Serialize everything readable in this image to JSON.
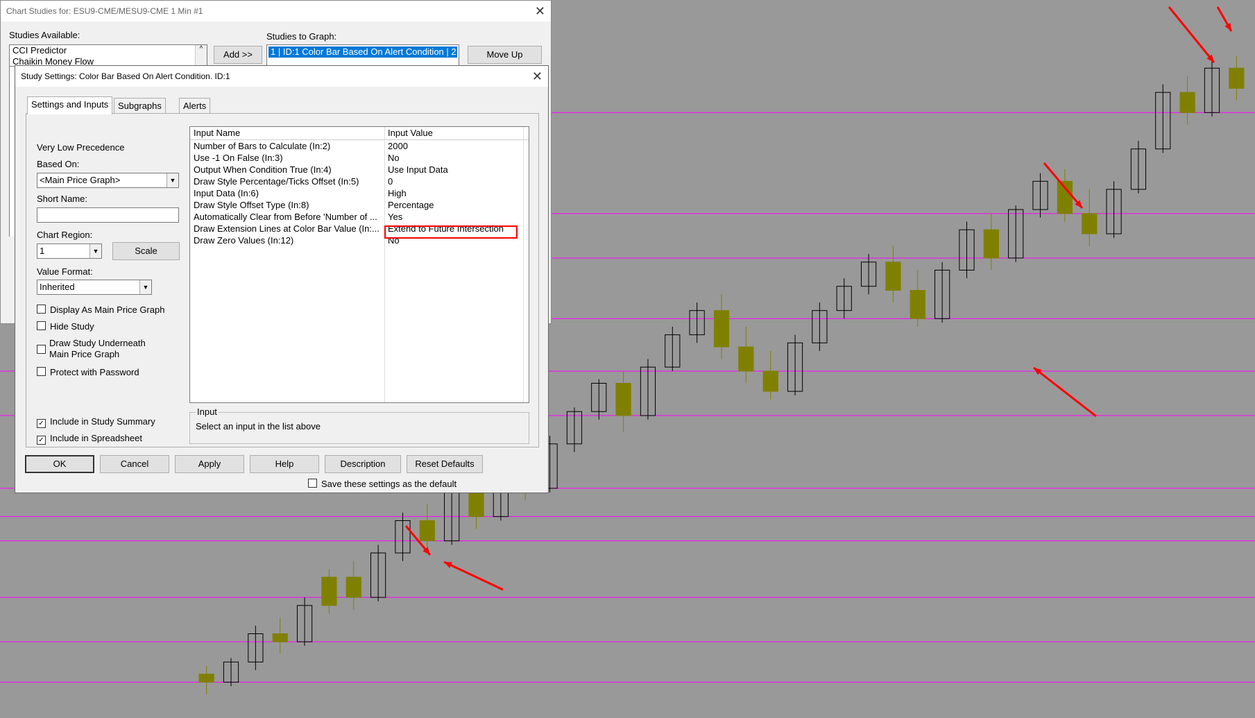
{
  "outer_window": {
    "title": "Chart Studies for: ESU9-CME/MESU9-CME  1 Min  #1",
    "studies_available_label": "Studies Available:",
    "studies_available": [
      "CCI Predictor",
      "Chaikin Money Flow"
    ],
    "add_button": "Add >>",
    "studies_to_graph_label": "Studies to Graph:",
    "studies_to_graph": [
      "1 | ID:1  Color Bar Based On Alert Condition | 2"
    ],
    "move_up_button": "Move Up"
  },
  "dialog": {
    "title": "Study Settings: Color Bar Based On Alert Condition. ID:1",
    "tabs": [
      {
        "label": "Settings and Inputs",
        "active": true
      },
      {
        "label": "Subgraphs",
        "active": false
      },
      {
        "label": "Alerts",
        "active": false
      }
    ],
    "precedence": "Very Low Precedence",
    "based_on_label": "Based On:",
    "based_on_value": "<Main Price Graph>",
    "short_name_label": "Short Name:",
    "short_name_value": "",
    "chart_region_label": "Chart Region:",
    "chart_region_value": "1",
    "scale_button": "Scale",
    "value_format_label": "Value Format:",
    "value_format_value": "Inherited",
    "checkboxes_top": [
      {
        "label": "Display As Main Price Graph",
        "checked": false
      },
      {
        "label": "Hide Study",
        "checked": false
      },
      {
        "label": "Draw Study Underneath Main Price Graph",
        "checked": false
      },
      {
        "label": "Protect with Password",
        "checked": false
      }
    ],
    "draw_underneath_line1": "Draw Study Underneath",
    "draw_underneath_line2": "Main Price Graph",
    "checkboxes_bottom": [
      {
        "label": "Include in Study Summary",
        "checked": true
      },
      {
        "label": "Include in Spreadsheet",
        "checked": true
      }
    ],
    "grid": {
      "col_name": "Input Name",
      "col_value": "Input Value",
      "rows": [
        {
          "name": "Number of Bars to Calculate  (In:2)",
          "value": "2000"
        },
        {
          "name": "Use -1 On False  (In:3)",
          "value": "No"
        },
        {
          "name": "Output When Condition True  (In:4)",
          "value": "Use Input Data"
        },
        {
          "name": "Draw Style Percentage/Ticks Offset  (In:5)",
          "value": "0"
        },
        {
          "name": "Input Data  (In:6)",
          "value": "High"
        },
        {
          "name": "Draw Style Offset Type  (In:8)",
          "value": "Percentage"
        },
        {
          "name": "Automatically Clear from Before 'Number of ...",
          "value": "Yes"
        },
        {
          "name": "Draw Extension Lines at Color Bar Value  (In:...",
          "value": "Extend to Future Intersection"
        },
        {
          "name": "Draw Zero Values  (In:12)",
          "value": "No"
        }
      ]
    },
    "input_group_label": "Input",
    "input_help": "Select an input in the list above",
    "buttons": {
      "ok": "OK",
      "cancel": "Cancel",
      "apply": "Apply",
      "help": "Help",
      "description": "Description",
      "reset": "Reset Defaults"
    },
    "save_default_label": "Save these settings as the default",
    "save_default_checked": false
  },
  "colors": {
    "chart_bg": "#999999",
    "bar_color": "#808000",
    "candle_outline": "#000000",
    "extension_line": "#ff00ff",
    "arrow": "#ff0000",
    "highlight_box": "#ff0000",
    "selection": "#0078d7"
  },
  "chart_data": {
    "type": "candlestick",
    "title": "",
    "series": [
      {
        "open": 1,
        "high": 1.2,
        "low": 0.5,
        "close": 0.8,
        "colored": true
      },
      {
        "open": 0.8,
        "high": 1.4,
        "low": 0.7,
        "close": 1.3,
        "colored": false
      },
      {
        "open": 1.3,
        "high": 2.2,
        "low": 1.1,
        "close": 2.0,
        "colored": false
      },
      {
        "open": 2.0,
        "high": 2.4,
        "low": 1.5,
        "close": 1.8,
        "colored": true
      },
      {
        "open": 1.8,
        "high": 2.9,
        "low": 1.7,
        "close": 2.7,
        "colored": false
      },
      {
        "open": 2.7,
        "high": 3.6,
        "low": 2.5,
        "close": 3.4,
        "colored": true
      },
      {
        "open": 3.4,
        "high": 3.8,
        "low": 2.6,
        "close": 2.9,
        "colored": true
      },
      {
        "open": 2.9,
        "high": 4.2,
        "low": 2.8,
        "close": 4.0,
        "colored": false
      },
      {
        "open": 4.0,
        "high": 5.0,
        "low": 3.8,
        "close": 4.8,
        "colored": false
      },
      {
        "open": 4.8,
        "high": 5.2,
        "low": 4.0,
        "close": 4.3,
        "colored": true
      },
      {
        "open": 4.3,
        "high": 5.6,
        "low": 4.2,
        "close": 5.5,
        "colored": false
      },
      {
        "open": 5.5,
        "high": 6.0,
        "low": 4.6,
        "close": 4.9,
        "colored": true
      },
      {
        "open": 4.9,
        "high": 6.4,
        "low": 4.8,
        "close": 6.2,
        "colored": false
      },
      {
        "open": 6.2,
        "high": 6.5,
        "low": 5.3,
        "close": 5.6,
        "colored": true
      },
      {
        "open": 5.6,
        "high": 6.9,
        "low": 5.5,
        "close": 6.7,
        "colored": false
      },
      {
        "open": 6.7,
        "high": 7.6,
        "low": 6.5,
        "close": 7.5,
        "colored": false
      },
      {
        "open": 7.5,
        "high": 8.3,
        "low": 7.3,
        "close": 8.2,
        "colored": false
      },
      {
        "open": 8.2,
        "high": 8.5,
        "low": 7.0,
        "close": 7.4,
        "colored": true
      },
      {
        "open": 7.4,
        "high": 8.8,
        "low": 7.3,
        "close": 8.6,
        "colored": false
      },
      {
        "open": 8.6,
        "high": 9.6,
        "low": 8.5,
        "close": 9.4,
        "colored": false
      },
      {
        "open": 9.4,
        "high": 10.2,
        "low": 9.2,
        "close": 10.0,
        "colored": false
      },
      {
        "open": 10.0,
        "high": 10.4,
        "low": 8.8,
        "close": 9.1,
        "colored": true
      },
      {
        "open": 9.1,
        "high": 9.6,
        "low": 8.2,
        "close": 8.5,
        "colored": true
      },
      {
        "open": 8.5,
        "high": 9.0,
        "low": 7.8,
        "close": 8.0,
        "colored": true
      },
      {
        "open": 8.0,
        "high": 9.4,
        "low": 7.9,
        "close": 9.2,
        "colored": false
      },
      {
        "open": 9.2,
        "high": 10.2,
        "low": 9.0,
        "close": 10.0,
        "colored": false
      },
      {
        "open": 10.0,
        "high": 10.8,
        "low": 9.8,
        "close": 10.6,
        "colored": false
      },
      {
        "open": 10.6,
        "high": 11.4,
        "low": 10.4,
        "close": 11.2,
        "colored": false
      },
      {
        "open": 11.2,
        "high": 11.6,
        "low": 10.2,
        "close": 10.5,
        "colored": true
      },
      {
        "open": 10.5,
        "high": 11.0,
        "low": 9.6,
        "close": 9.8,
        "colored": true
      },
      {
        "open": 9.8,
        "high": 11.2,
        "low": 9.7,
        "close": 11.0,
        "colored": false
      },
      {
        "open": 11.0,
        "high": 12.2,
        "low": 10.8,
        "close": 12.0,
        "colored": false
      },
      {
        "open": 12.0,
        "high": 12.4,
        "low": 11.0,
        "close": 11.3,
        "colored": true
      },
      {
        "open": 11.3,
        "high": 12.6,
        "low": 11.2,
        "close": 12.5,
        "colored": false
      },
      {
        "open": 12.5,
        "high": 13.4,
        "low": 12.3,
        "close": 13.2,
        "colored": false
      },
      {
        "open": 13.2,
        "high": 13.5,
        "low": 12.2,
        "close": 12.4,
        "colored": true
      },
      {
        "open": 12.4,
        "high": 13.0,
        "low": 11.6,
        "close": 11.9,
        "colored": true
      },
      {
        "open": 11.9,
        "high": 13.2,
        "low": 11.8,
        "close": 13.0,
        "colored": false
      },
      {
        "open": 13.0,
        "high": 14.2,
        "low": 12.9,
        "close": 14.0,
        "colored": false
      },
      {
        "open": 14.0,
        "high": 15.6,
        "low": 13.9,
        "close": 15.4,
        "colored": false
      },
      {
        "open": 15.4,
        "high": 15.8,
        "low": 14.6,
        "close": 14.9,
        "colored": true
      },
      {
        "open": 14.9,
        "high": 16.2,
        "low": 14.8,
        "close": 16.0,
        "colored": false
      },
      {
        "open": 16.0,
        "high": 16.3,
        "low": 15.2,
        "close": 15.5,
        "colored": true
      }
    ],
    "extension_levels": [
      0.8,
      1.8,
      2.9,
      4.3,
      4.9,
      5.6,
      7.4,
      8.5,
      9.8,
      11.3,
      12.4,
      14.9
    ]
  }
}
